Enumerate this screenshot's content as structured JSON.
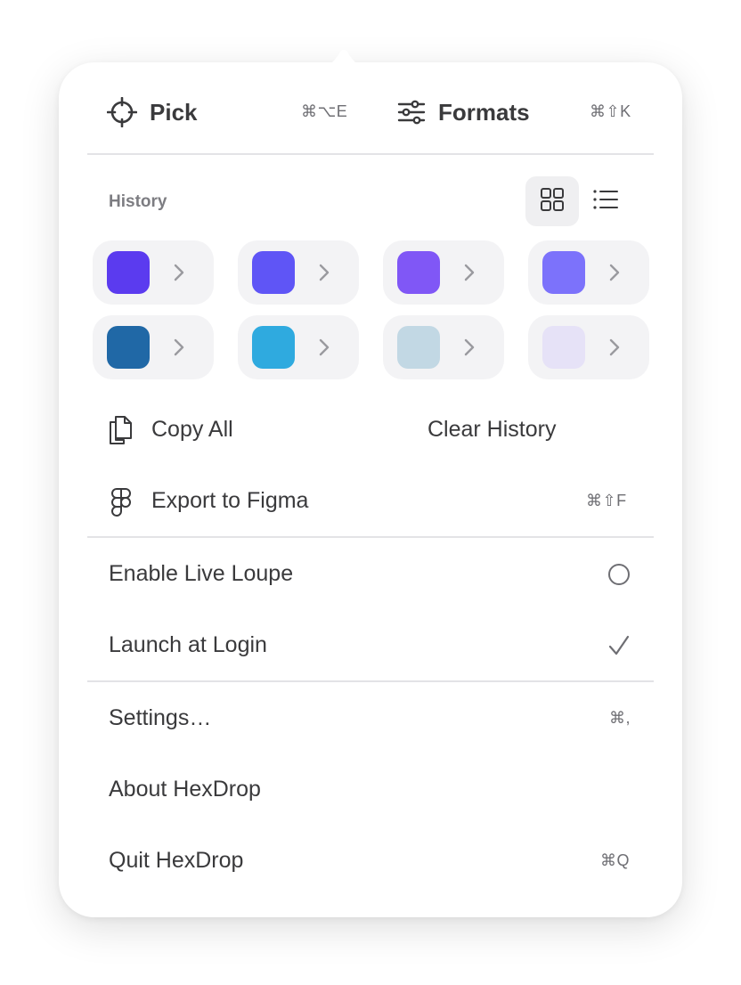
{
  "header": {
    "pick": {
      "label": "Pick",
      "shortcut": "⌘⌥E",
      "icon": "crosshair-icon"
    },
    "formats": {
      "label": "Formats",
      "shortcut": "⌘⇧K",
      "icon": "sliders-icon"
    }
  },
  "history": {
    "label": "History",
    "view_modes": [
      "grid-icon",
      "list-icon"
    ],
    "active_view": "grid",
    "swatches": [
      {
        "color": "#5B3BEF"
      },
      {
        "color": "#5F55F6"
      },
      {
        "color": "#8057F6"
      },
      {
        "color": "#7C72FB"
      },
      {
        "color": "#2068A6"
      },
      {
        "color": "#2FAADF"
      },
      {
        "color": "#C2D8E4"
      },
      {
        "color": "#E6E2F7"
      }
    ],
    "copy_all": "Copy All",
    "clear_history": "Clear History"
  },
  "export": {
    "label": "Export to Figma",
    "shortcut": "⌘⇧F",
    "icon": "figma-icon"
  },
  "toggles": {
    "live_loupe": {
      "label": "Enable Live Loupe",
      "state": "off"
    },
    "launch_at_login": {
      "label": "Launch at Login",
      "state": "checked"
    }
  },
  "menu": {
    "settings": {
      "label": "Settings…",
      "shortcut": "⌘,"
    },
    "about": {
      "label": "About HexDrop"
    },
    "quit": {
      "label": "Quit HexDrop",
      "shortcut": "⌘Q"
    }
  },
  "colors": {
    "text": "#3a3a3c",
    "secondary": "#6e6e73",
    "card": "#f3f3f5",
    "separator": "#e3e3e6"
  }
}
